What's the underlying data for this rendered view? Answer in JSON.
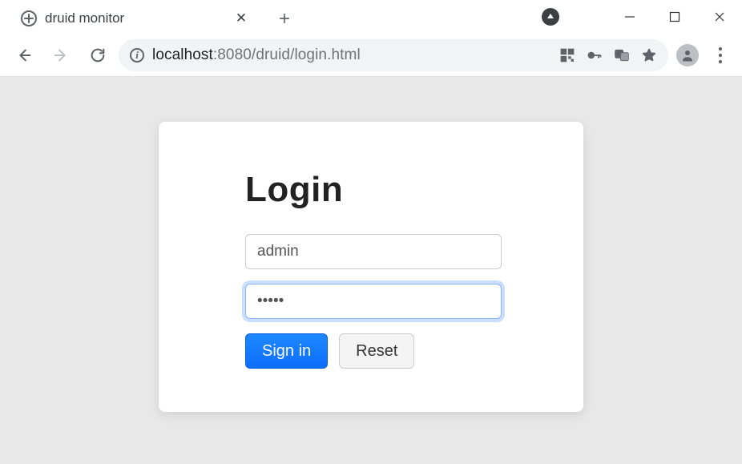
{
  "browser": {
    "tab_title": "druid monitor",
    "url_host": "localhost",
    "url_port_path": ":8080/druid/login.html"
  },
  "login": {
    "heading": "Login",
    "username_value": "admin",
    "password_value": "•••••",
    "signin_label": "Sign in",
    "reset_label": "Reset"
  }
}
